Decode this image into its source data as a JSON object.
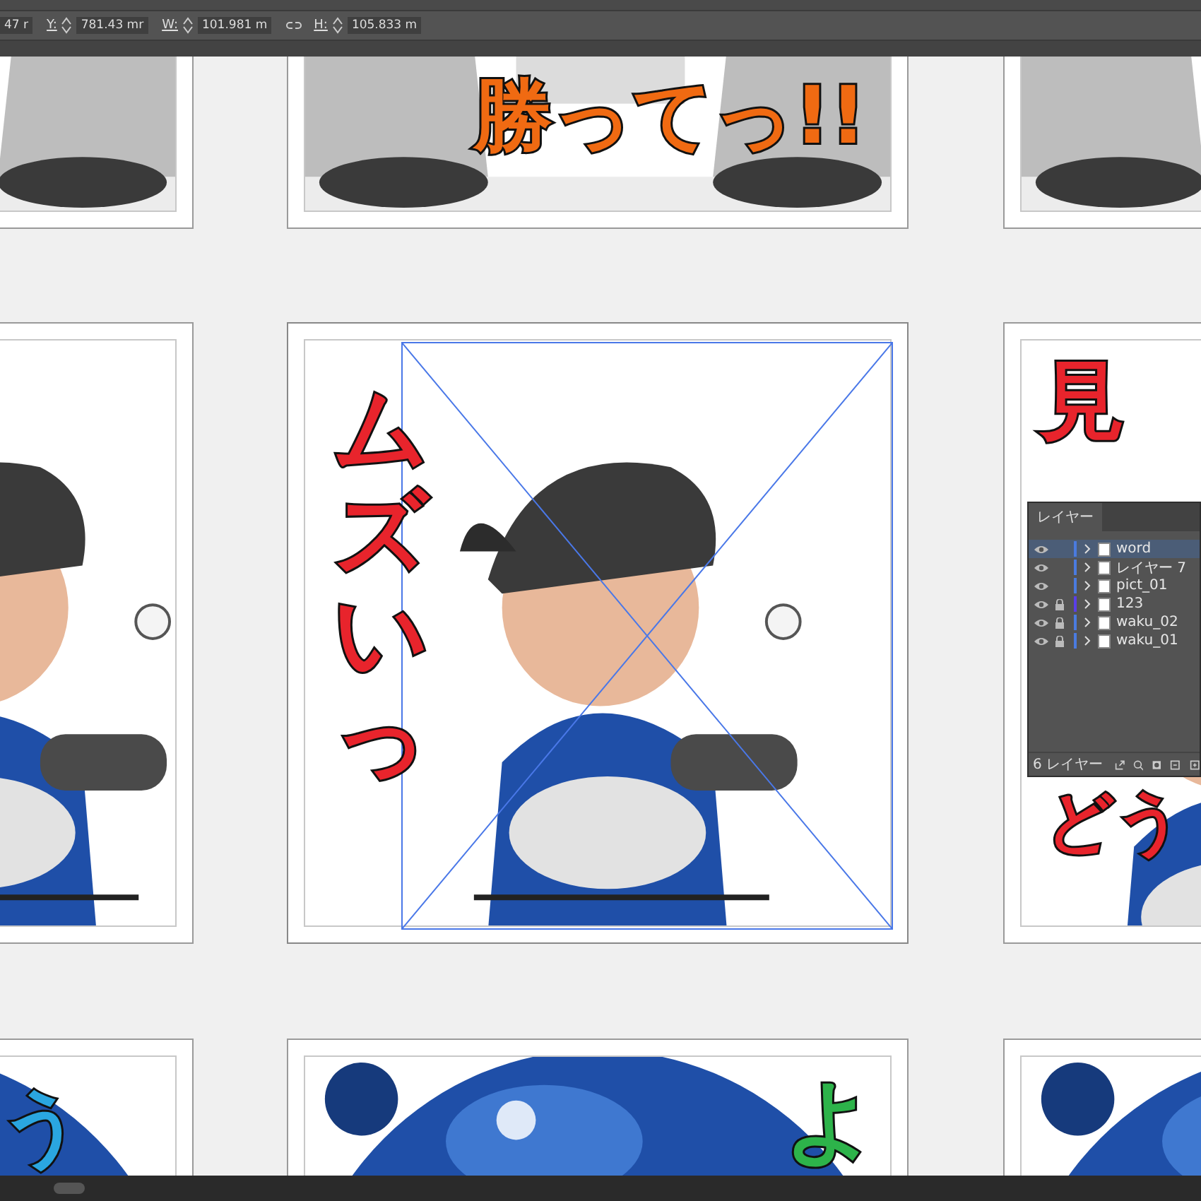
{
  "control_bar": {
    "fields": [
      {
        "value": "47 r"
      },
      {
        "label": "Y:",
        "value": "781.43 mr"
      },
      {
        "label": "W:",
        "value": "101.981 m"
      },
      {
        "label": "H:",
        "value": "105.833 m"
      }
    ]
  },
  "artboards": [
    {
      "kind": "picture",
      "selected": false
    },
    {
      "kind": "picture",
      "selected": false,
      "lettering": {
        "text": "勝ってっ!!",
        "color": "#f06a12"
      }
    },
    {
      "kind": "picture",
      "selected": false
    },
    {
      "kind": "picture",
      "selected": false
    },
    {
      "kind": "picture",
      "selected": true,
      "lettering": {
        "text": "ムズいっ",
        "color": "#e8242c"
      }
    },
    {
      "kind": "picture",
      "selected": false,
      "lettering": {
        "text": "見",
        "color": "#e8242c"
      }
    },
    {
      "kind": "picture",
      "selected": false,
      "lettering": {
        "text": "う",
        "color": "#2aa6e0"
      }
    },
    {
      "kind": "picture",
      "selected": false,
      "lettering": {
        "text": "よ",
        "color": "#2db34a"
      }
    },
    {
      "kind": "picture",
      "selected": false
    }
  ],
  "extra_lettering": [
    {
      "text": "どう",
      "color": "#e8242c"
    }
  ],
  "layers_panel": {
    "tab": "レイヤー",
    "layers": [
      {
        "name": "word",
        "visible": true,
        "locked": false,
        "selected": true,
        "color": "#4a7be0"
      },
      {
        "name": "レイヤー 7",
        "visible": true,
        "locked": false,
        "selected": false,
        "color": "#4a7be0"
      },
      {
        "name": "pict_01",
        "visible": true,
        "locked": false,
        "selected": false,
        "color": "#4a7be0"
      },
      {
        "name": "123",
        "visible": true,
        "locked": true,
        "selected": false,
        "color": "#5a3ee8"
      },
      {
        "name": "waku_02",
        "visible": true,
        "locked": true,
        "selected": false,
        "color": "#4a7be0"
      },
      {
        "name": "waku_01",
        "visible": true,
        "locked": true,
        "selected": false,
        "color": "#4a7be0"
      }
    ],
    "count": "6 レイヤー"
  }
}
